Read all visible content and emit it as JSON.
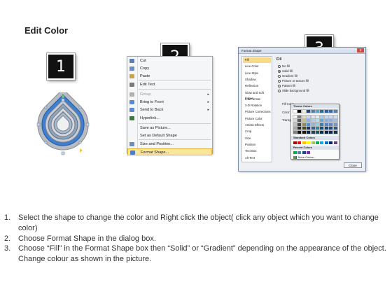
{
  "page": {
    "title": "Edit Color"
  },
  "badges": [
    "1",
    "2",
    "3"
  ],
  "context_menu": {
    "items": [
      {
        "label": "Cut",
        "underline": "t",
        "icon": "scissors-icon",
        "icon_color": "#5b7fb6",
        "state": "normal"
      },
      {
        "label": "Copy",
        "icon": "copy-icon",
        "icon_color": "#6a8cc4",
        "state": "normal"
      },
      {
        "label": "Paste",
        "icon": "paste-icon",
        "icon_color": "#c9a24a",
        "state": "normal"
      },
      {
        "label": "Edit Text",
        "icon": "edit-text-icon",
        "icon_color": "#7a7a7a",
        "state": "normal"
      },
      {
        "label": "Group",
        "icon": "group-icon",
        "icon_color": "#b0b0b0",
        "state": "disabled",
        "submenu": true
      },
      {
        "label": "Bring to Front",
        "icon": "bring-front-icon",
        "icon_color": "#5a8ad0",
        "state": "normal",
        "submenu": true
      },
      {
        "label": "Send to Back",
        "icon": "send-back-icon",
        "icon_color": "#5a8ad0",
        "state": "normal",
        "submenu": true
      },
      {
        "label": "Hyperlink...",
        "icon": "hyperlink-icon",
        "icon_color": "#3a7a3a",
        "state": "normal"
      },
      {
        "label": "Save as Picture...",
        "icon": "",
        "icon_color": "",
        "state": "normal"
      },
      {
        "label": "Set as Default Shape",
        "icon": "",
        "icon_color": "",
        "state": "normal"
      },
      {
        "label": "Size and Position...",
        "icon": "size-position-icon",
        "icon_color": "#6b8db8",
        "state": "normal"
      },
      {
        "label": "Format Shape...",
        "icon": "format-shape-icon",
        "icon_color": "#4a7fc6",
        "state": "highlight"
      }
    ]
  },
  "dialog": {
    "title": "Format Shape",
    "close_glyph": "x",
    "nav_items": [
      "Fill",
      "Line Color",
      "Line Style",
      "Shadow",
      "Reflection",
      "Glow and Soft Edges",
      "3-D Format",
      "3-D Rotation",
      "Picture Corrections",
      "Picture Color",
      "Artistic Effects",
      "Crop",
      "Size",
      "Position",
      "Text Box",
      "Alt Text"
    ],
    "active_nav": "Fill",
    "content_heading": "Fill",
    "fill_options": [
      {
        "label": "No fill",
        "checked": false
      },
      {
        "label": "Solid fill",
        "checked": true
      },
      {
        "label": "Gradient fill",
        "checked": false
      },
      {
        "label": "Picture or texture fill",
        "checked": false
      },
      {
        "label": "Pattern fill",
        "checked": false
      },
      {
        "label": "Slide background fill",
        "checked": false
      }
    ],
    "fill_color_label": "Fill Color",
    "color_label": "Color:",
    "transparency_label": "Transparency:",
    "close_button": "Close"
  },
  "palette": {
    "theme_header": "Theme Colors",
    "standard_header": "Standard Colors",
    "recent_header": "Recent Colors",
    "more_colors": "More Colors...",
    "theme_columns": [
      [
        "#ffffff",
        "#f2f2f2",
        "#d9d9d9",
        "#bfbfbf",
        "#a6a6a6",
        "#808080"
      ],
      [
        "#000000",
        "#7f7f7f",
        "#595959",
        "#404040",
        "#262626",
        "#0d0d0d"
      ],
      [
        "#eeece1",
        "#ddd9c3",
        "#c4bd97",
        "#948a54",
        "#4a452a",
        "#1d1b10"
      ],
      [
        "#1f497d",
        "#c6d9f0",
        "#8db3e2",
        "#548dd4",
        "#17365d",
        "#0f243e"
      ],
      [
        "#4f81bd",
        "#dbe5f1",
        "#b8cce4",
        "#95b3d7",
        "#366092",
        "#244061"
      ],
      [
        "#4bacc6",
        "#daeef3",
        "#b7dde8",
        "#92cddc",
        "#31859b",
        "#205867"
      ],
      [
        "#1f6fa8",
        "#a9cde8",
        "#6aa8d6",
        "#2e7fc0",
        "#134d7a",
        "#0b3050"
      ],
      [
        "#2d5f9e",
        "#c9d7ee",
        "#8faed9",
        "#5885c4",
        "#1d3f6b",
        "#102542"
      ],
      [
        "#3b6aa8",
        "#cbd8ec",
        "#93b0d8",
        "#6089c3",
        "#274672",
        "#16294a"
      ],
      [
        "#4a7fc6",
        "#d2def0",
        "#a1bde3",
        "#7099d1",
        "#305487",
        "#1a3050"
      ]
    ],
    "standard_colors": [
      "#c00000",
      "#ff0000",
      "#ffc000",
      "#ffff00",
      "#92d050",
      "#00b050",
      "#00b0f0",
      "#0070c0",
      "#002060",
      "#7030a0"
    ],
    "recent_colors": [
      "#00b050",
      "#4f81bd",
      "#1f497d",
      "#7030a0"
    ]
  },
  "instructions": [
    {
      "num": "1.",
      "text": "Select the shape to change the color and Right click the object( click any object which you want to change color)"
    },
    {
      "num": "2.",
      "text": "Choose Format Shape in the dialog box."
    },
    {
      "num": "3.",
      "text": "Choose “Fill” in the Format Shape box then “Solid” or “Gradient” depending on the appearance of the object. Change colour as shown in the picture."
    }
  ]
}
